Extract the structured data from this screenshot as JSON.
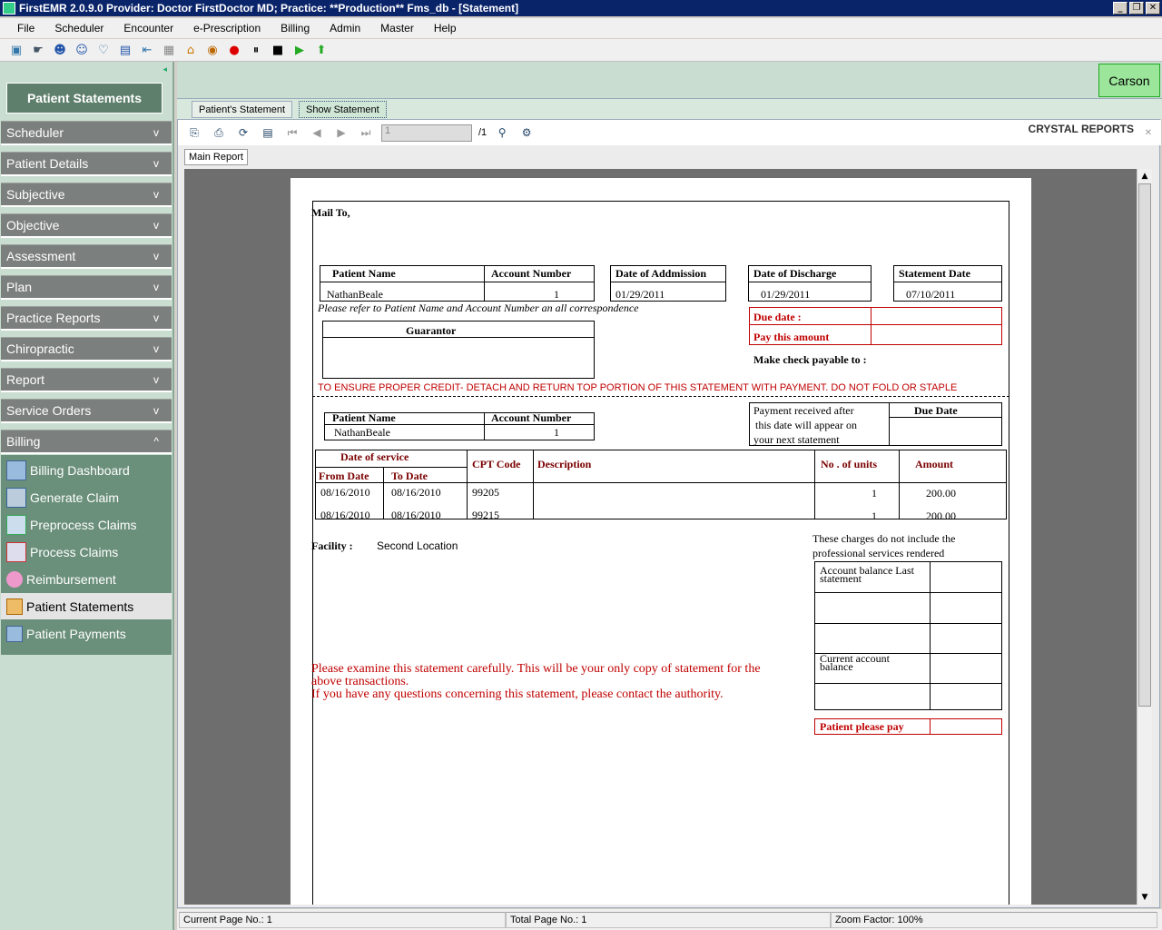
{
  "window": {
    "title": "FirstEMR 2.0.9.0 Provider: Doctor FirstDoctor MD; Practice: **Production** Fms_db - [Statement]",
    "minimize": "_",
    "restore": "❐",
    "close": "✕"
  },
  "menu": [
    "File",
    "Scheduler",
    "Encounter",
    "e-Prescription",
    "Billing",
    "Admin",
    "Master",
    "Help"
  ],
  "sidebar": {
    "header": "Patient Statements",
    "sections": [
      {
        "label": "Scheduler",
        "chev": "v"
      },
      {
        "label": "Patient Details",
        "chev": "v"
      },
      {
        "label": "Subjective",
        "chev": "v"
      },
      {
        "label": "Objective",
        "chev": "v"
      },
      {
        "label": "Assessment",
        "chev": "v"
      },
      {
        "label": "Plan",
        "chev": "v"
      },
      {
        "label": "Practice Reports",
        "chev": "v"
      },
      {
        "label": "Chiropractic",
        "chev": "v"
      },
      {
        "label": "Report",
        "chev": "v"
      },
      {
        "label": "Service Orders",
        "chev": "v"
      },
      {
        "label": "Billing",
        "chev": "^"
      }
    ],
    "billing_items": [
      "Billing Dashboard",
      "Generate Claim",
      "Preprocess Claims",
      "Process Claims",
      "Reimbursement",
      "Patient Statements",
      "Patient Payments"
    ]
  },
  "user_button": "Carson",
  "tabs": [
    "Patient's Statement",
    "Show Statement"
  ],
  "viewer": {
    "page_value": "1",
    "page_total": "/1",
    "brand": "CRYSTAL REPORTS",
    "main_report_tab": "Main Report"
  },
  "statement": {
    "mail_to": "Mail To,",
    "patient_name_label": "Patient Name",
    "account_number_label": "Account Number",
    "date_admission_label": "Date of Addmission",
    "date_discharge_label": "Date of Discharge",
    "statement_date_label": "Statement Date",
    "patient_name": "NathanBeale",
    "account_number": "1",
    "date_admission": "01/29/2011",
    "date_discharge": "01/29/2011",
    "statement_date": "07/10/2011",
    "refer_note": "Please refer to Patient Name and Account Number an all correspondence",
    "guarantor_label": "Guarantor",
    "due_date_label": "Due date   :",
    "pay_amount_label": "Pay this amount",
    "check_payable": "Make check payable to     :",
    "detach_note": "TO ENSURE PROPER CREDIT-  DETACH AND RETURN TOP PORTION OF THIS STATEMENT WITH PAYMENT.  DO NOT FOLD OR STAPLE",
    "payment_note_1": "Payment received after",
    "payment_note_2": "this date will appear on",
    "payment_note_3": "your next statement",
    "due_date_col": "Due Date",
    "date_of_service_label": "Date of service",
    "from_date_label": "From Date",
    "to_date_label": "To Date",
    "cpt_label": "CPT Code",
    "description_label": "Description",
    "units_label": "No . of units",
    "amount_label": "Amount",
    "services": [
      {
        "from": "08/16/2010",
        "to": "08/16/2010",
        "cpt": "99205",
        "units": "1",
        "amount": "200.00"
      },
      {
        "from": "08/16/2010",
        "to": "08/16/2010",
        "cpt": "99215",
        "units": "1",
        "amount": "200.00"
      }
    ],
    "facility_label": "Facility  :",
    "facility_value": "Second Location",
    "charges_note_1": "These charges do not include the",
    "charges_note_2": "professional services rendered",
    "balance_last_1": "Account balance Last",
    "balance_last_2": "statement",
    "current_balance_1": "Current account",
    "current_balance_2": "balance",
    "patient_pay_label": "Patient please pay",
    "examine_note_1": "Please examine this statement carefully. This will be your only copy of statement for the",
    "examine_note_2": "above transactions.",
    "examine_note_3": "If you have any questions concerning this statement, please contact the authority."
  },
  "status": {
    "current_page": "Current Page No.: 1",
    "total_page": "Total Page No.: 1",
    "zoom": "Zoom Factor: 100%"
  }
}
